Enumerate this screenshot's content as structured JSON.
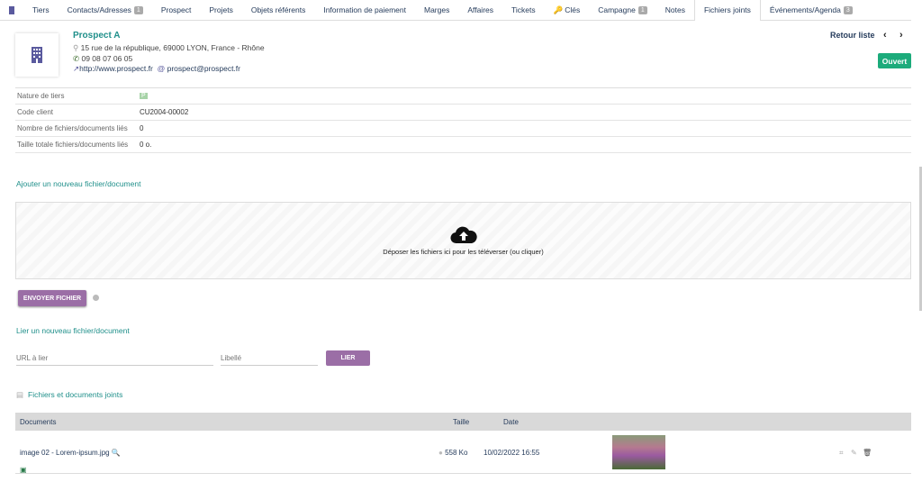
{
  "tabs": [
    {
      "label": "Tiers"
    },
    {
      "label": "Contacts/Adresses",
      "badge": "1"
    },
    {
      "label": "Prospect"
    },
    {
      "label": "Projets"
    },
    {
      "label": "Objets référents"
    },
    {
      "label": "Information de paiement"
    },
    {
      "label": "Marges"
    },
    {
      "label": "Affaires"
    },
    {
      "label": "Tickets"
    },
    {
      "label": "Clés"
    },
    {
      "label": "Campagne",
      "badge": "1"
    },
    {
      "label": "Notes"
    },
    {
      "label": "Fichiers joints"
    },
    {
      "label": "Événements/Agenda",
      "badge": "3"
    }
  ],
  "header": {
    "name": "Prospect A",
    "address": "15 rue de la république, 69000 LYON, France - Rhône",
    "phone": "09 08 07 06 05",
    "website": "http://www.prospect.fr",
    "email": "prospect@prospect.fr",
    "back": "Retour liste",
    "status": "Ouvert",
    "prev": "‹",
    "next": "›"
  },
  "fields": [
    {
      "label": "Nature de tiers",
      "value": "P"
    },
    {
      "label": "Code client",
      "value": "CU2004-00002"
    },
    {
      "label": "Nombre de fichiers/documents liés",
      "value": "0"
    },
    {
      "label": "Taille totale fichiers/documents liés",
      "value": "0 o."
    }
  ],
  "upload": {
    "title": "Ajouter un nouveau fichier/document",
    "drop": "Déposer les fichiers ici pour les téléverser (ou cliquer)",
    "button": "ENVOYER FICHIER"
  },
  "link": {
    "title": "Lier un nouveau fichier/document",
    "url_placeholder": "URL à lier",
    "label_placeholder": "Libellé",
    "button": "LIER"
  },
  "files": {
    "title": "Fichiers et documents joints",
    "columns": [
      "Documents",
      "Taille",
      "Date"
    ],
    "rows": [
      {
        "name": "image 02 - Lorem-ipsum.jpg",
        "size": "558 Ko",
        "date": "10/02/2022 16:55"
      }
    ]
  }
}
